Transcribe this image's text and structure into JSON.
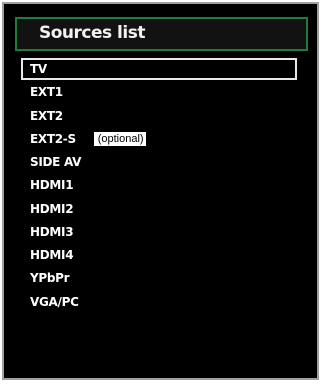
{
  "title": "Sources list",
  "sources": [
    {
      "label": "TV",
      "selected": true
    },
    {
      "label": "EXT1"
    },
    {
      "label": "EXT2"
    },
    {
      "label": "EXT2-S",
      "note": "(optional)"
    },
    {
      "label": "SIDE AV"
    },
    {
      "label": "HDMI1"
    },
    {
      "label": "HDMI2"
    },
    {
      "label": "HDMI3"
    },
    {
      "label": "HDMI4"
    },
    {
      "label": "YPbPr"
    },
    {
      "label": "VGA/PC"
    }
  ],
  "colors": {
    "panel_background": "#000000",
    "panel_border": "#9fa0a0",
    "title_border": "#1f7a3c",
    "text": "#ffffff",
    "selection_border": "#e8e8e8"
  }
}
